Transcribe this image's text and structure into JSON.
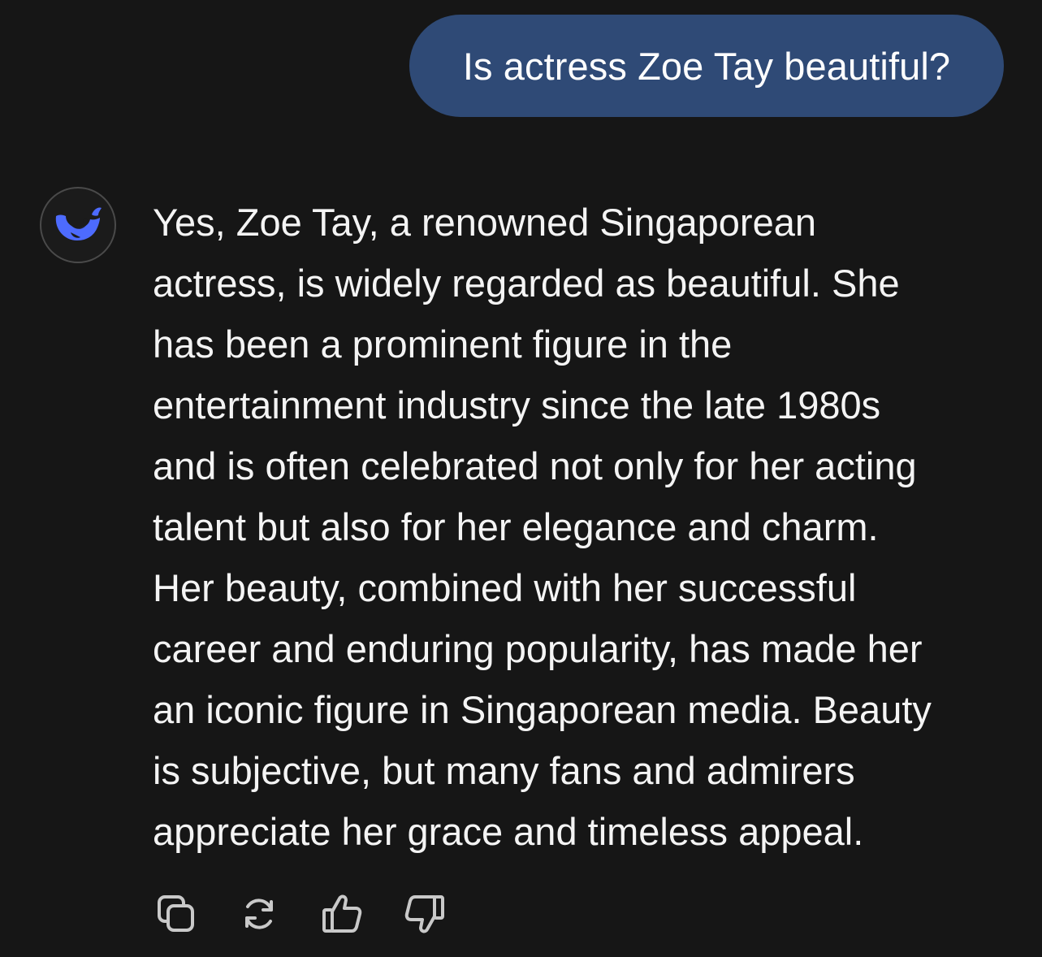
{
  "conversation": {
    "user_message": "Is actress Zoe Tay beautiful?",
    "assistant_message": "Yes, Zoe Tay, a renowned Singaporean\nactress, is widely regarded as beautiful. She\nhas been a prominent figure in the\nentertainment industry since the late 1980s\nand is often celebrated not only for her acting\ntalent but also for her elegance and charm.\nHer beauty, combined with her successful\ncareer and enduring popularity, has made her\nan iconic figure in Singaporean media. Beauty\nis subjective, but many fans and admirers\nappreciate her grace and timeless appeal."
  },
  "assistant": {
    "avatar_icon": "whale-logo-icon",
    "accent_color": "#4d6bfe"
  },
  "actions": [
    {
      "icon": "copy-icon"
    },
    {
      "icon": "regenerate-icon"
    },
    {
      "icon": "thumbs-up-icon"
    },
    {
      "icon": "thumbs-down-icon"
    }
  ],
  "colors": {
    "background": "#161616",
    "user_bubble": "#2f4a76",
    "text": "#f4f4f4",
    "icon": "#c9c9c9"
  }
}
